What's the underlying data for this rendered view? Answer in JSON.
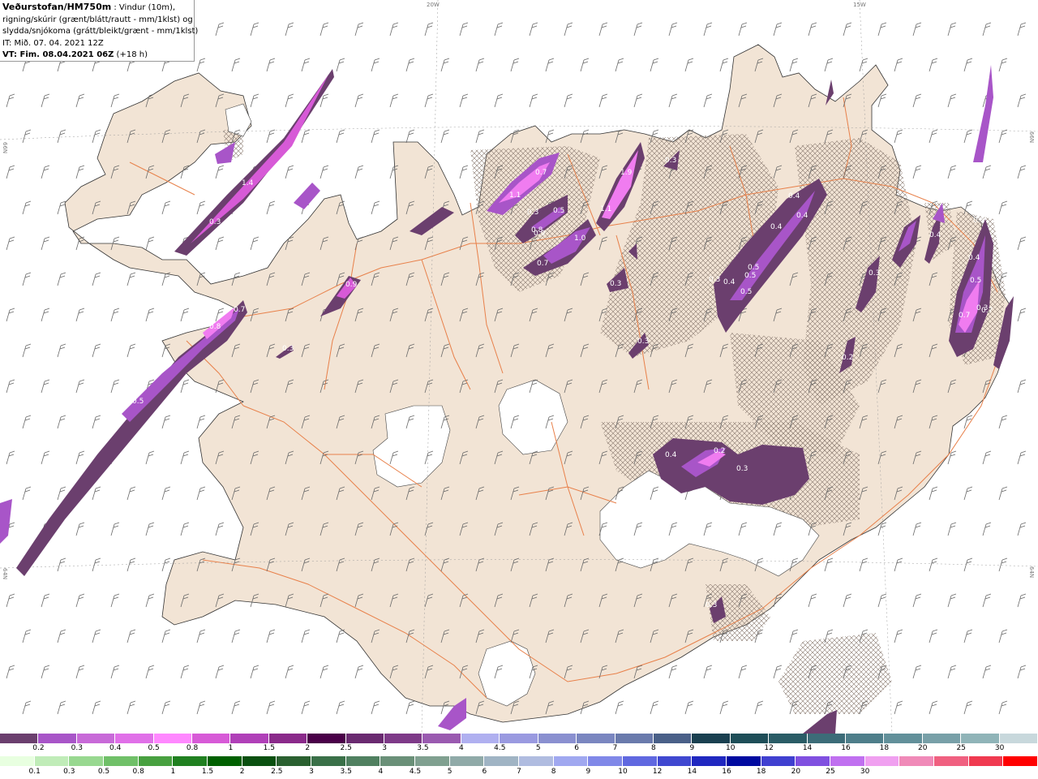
{
  "header": {
    "title": "Veðurstofan/HM750m",
    "title_suffix": " : Vindur (10m),",
    "line2": "rigning/skúrir (grænt/blátt/rautt - mm/1klst) og",
    "line3": "slydda/snjókoma (grátt/bleikt/grænt - mm/1klst)",
    "it": "IT: Mið. 07. 04. 2021 12Z",
    "vt_bold": "VT: Fim. 08.04.2021 06Z",
    "vt_lead": " (+18 h)"
  },
  "map": {
    "grid_labels": {
      "lon_20w": "20W",
      "lon_15w": "15W",
      "lat_66n_left": "66N",
      "lat_66n_right": "66N",
      "lat_64n_left": "64N",
      "lat_64n_right": "64N"
    },
    "colors": {
      "land": "#f2e4d5",
      "roads": "#e8804a",
      "glacier": "#ffffff",
      "sleet_dark": "#6b3f6e",
      "sleet_mid": "#a855c8",
      "sleet_light": "#f07cf0"
    },
    "precip_labels": [
      "0.7",
      "1.1",
      "0.3",
      "0.5",
      "0.8",
      "0.9",
      "1.9",
      "1.0",
      "0.7",
      "1.1",
      "0.3",
      "0.4",
      "0.4",
      "0.4",
      "0.5",
      "0.5",
      "0.3",
      "0.4",
      "0.5",
      "0.3",
      "0.3",
      "0.4",
      "0.5",
      "0.7",
      "0.2",
      "0.3",
      "0.4",
      "0.5",
      "0.3",
      "0.3",
      "0.7",
      "1.4",
      "0.7",
      "0.3",
      "0.9",
      "0.7",
      "0.8",
      "0.3",
      "0.5",
      "0.4",
      "0.2",
      "0.3"
    ]
  },
  "legend": {
    "snow_row_colors": [
      "#6b3f6e",
      "#a855c8",
      "#c86ad8",
      "#e070e8",
      "#ff88ff",
      "#d75ad7",
      "#b040b8",
      "#8a2a8a",
      "#4a0048",
      "#6a2a70",
      "#7e3a88",
      "#9a5ab0",
      "#b0b0f0",
      "#9a9ae0",
      "#8a90d0",
      "#7a86c0",
      "#6a7aac",
      "#4a6088",
      "#1a4050",
      "#1e4e58",
      "#2a5c66",
      "#3c6c78",
      "#4e7e8a",
      "#62909a",
      "#78a0a8",
      "#90b4b8",
      "#c8d8dc"
    ],
    "snow_row_labels": [
      "0.2",
      "0.3",
      "0.4",
      "0.5",
      "0.8",
      "1",
      "1.5",
      "2",
      "2.5",
      "3",
      "3.5",
      "4",
      "4.5",
      "5",
      "6",
      "7",
      "8",
      "9",
      "10",
      "12",
      "14",
      "16",
      "18",
      "20",
      "25",
      "30"
    ],
    "rain_row_colors": [
      "#e8ffe0",
      "#c0ecb8",
      "#98d890",
      "#70c068",
      "#48a040",
      "#208020",
      "#006000",
      "#0a5010",
      "#2a6030",
      "#3a7048",
      "#508060",
      "#6a9078",
      "#80a090",
      "#90aaa8",
      "#a0b4c4",
      "#b0bce0",
      "#a0a8f0",
      "#8088e8",
      "#6068e0",
      "#4048d0",
      "#2028c0",
      "#000aa0",
      "#4040d0",
      "#8050e0",
      "#c070f0",
      "#f0a0f0",
      "#f08ab8",
      "#f06080",
      "#f03a50",
      "#ff0000"
    ],
    "rain_row_labels": [
      "0.1",
      "0.3",
      "0.5",
      "0.8",
      "1",
      "1.5",
      "2",
      "2.5",
      "3",
      "3.5",
      "4",
      "4.5",
      "5",
      "6",
      "7",
      "8",
      "9",
      "10",
      "12",
      "14",
      "16",
      "18",
      "20",
      "25",
      "30"
    ]
  }
}
